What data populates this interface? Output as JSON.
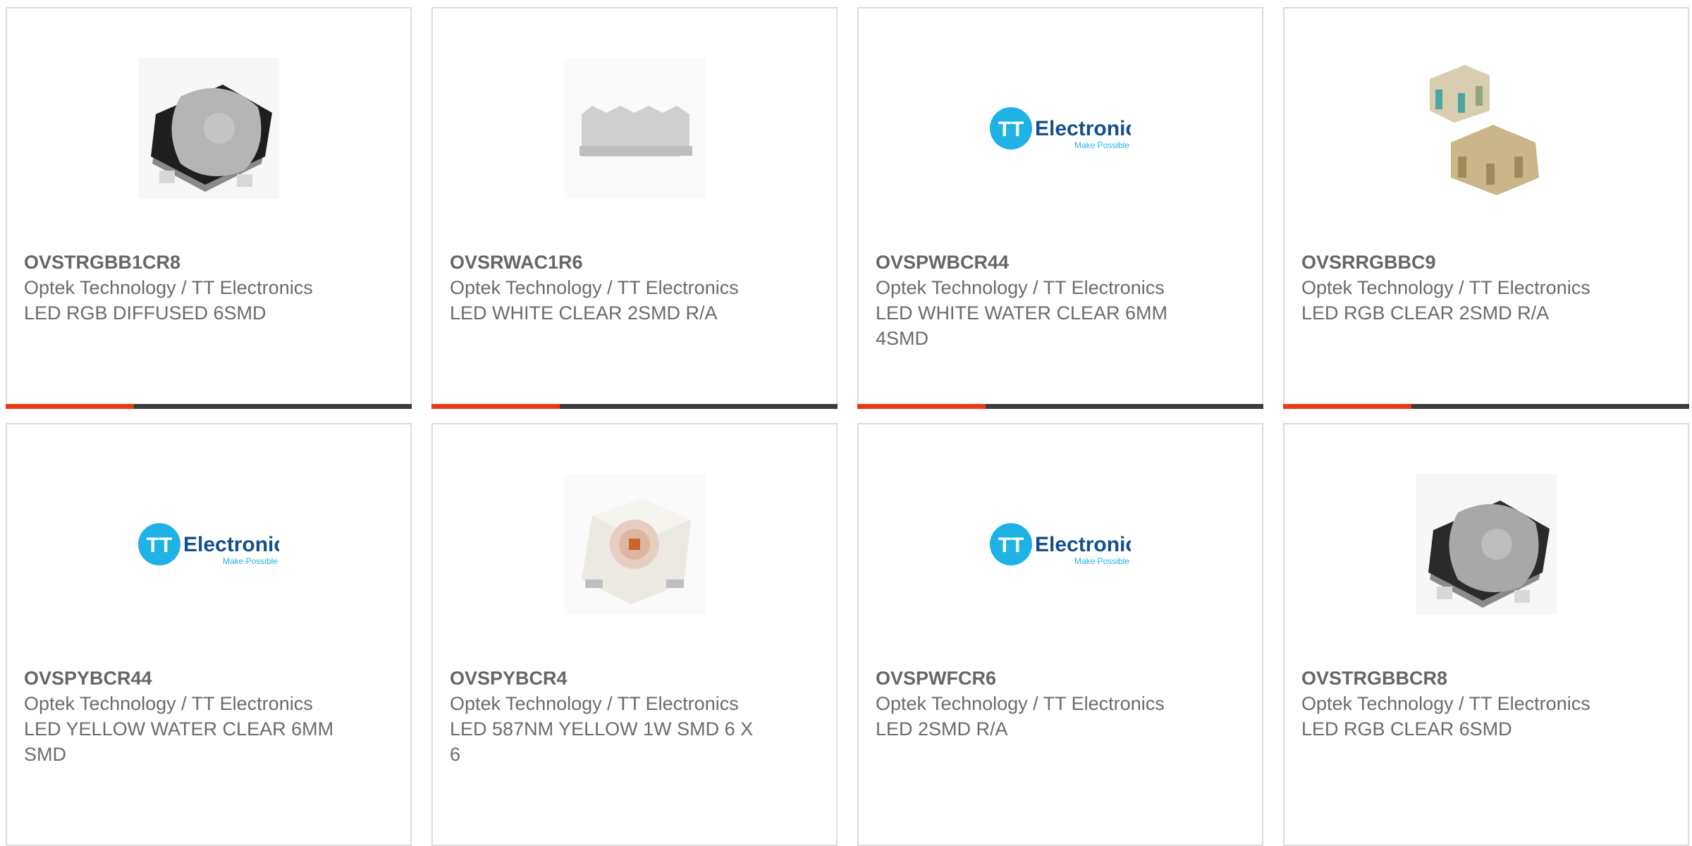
{
  "colors": {
    "accent_red": "#e83a14",
    "accent_dark": "#3c3c3c",
    "text": "#6b6b6b",
    "border": "#dcdcdc",
    "tt_blue": "#1fb3e5"
  },
  "products": [
    {
      "part_number": "OVSTRGBB1CR8",
      "manufacturer": "Optek Technology / TT Electronics",
      "description": "LED RGB DIFFUSED 6SMD",
      "image": "rgb-diffused-led-photo"
    },
    {
      "part_number": "OVSRWAC1R6",
      "manufacturer": "Optek Technology / TT Electronics",
      "description": "LED WHITE CLEAR 2SMD R/A",
      "image": "white-right-angle-led-photo"
    },
    {
      "part_number": "OVSPWBCR44",
      "manufacturer": "Optek Technology / TT Electronics",
      "description": "LED WHITE WATER CLEAR 6MM 4SMD",
      "image": "tt-electronics-logo",
      "logo": {
        "mark": "TT",
        "name": "Electronics",
        "tagline": "Make Possible"
      }
    },
    {
      "part_number": "OVSRRGBBC9",
      "manufacturer": "Optek Technology / TT Electronics",
      "description": "LED RGB CLEAR 2SMD R/A",
      "image": "rgb-right-angle-led-photo"
    },
    {
      "part_number": "OVSPYBCR44",
      "manufacturer": "Optek Technology / TT Electronics",
      "description": "LED YELLOW WATER CLEAR 6MM SMD",
      "image": "tt-electronics-logo",
      "logo": {
        "mark": "TT",
        "name": "Electronics",
        "tagline": "Make Possible"
      }
    },
    {
      "part_number": "OVSPYBCR4",
      "manufacturer": "Optek Technology / TT Electronics",
      "description": "LED 587NM YELLOW 1W SMD 6 X 6",
      "image": "yellow-power-led-photo"
    },
    {
      "part_number": "OVSPWFCR6",
      "manufacturer": "Optek Technology / TT Electronics",
      "description": "LED 2SMD R/A",
      "image": "tt-electronics-logo",
      "logo": {
        "mark": "TT",
        "name": "Electronics",
        "tagline": "Make Possible"
      }
    },
    {
      "part_number": "OVSTRGBBCR8",
      "manufacturer": "Optek Technology / TT Electronics",
      "description": "LED RGB CLEAR 6SMD",
      "image": "rgb-clear-led-photo"
    }
  ]
}
